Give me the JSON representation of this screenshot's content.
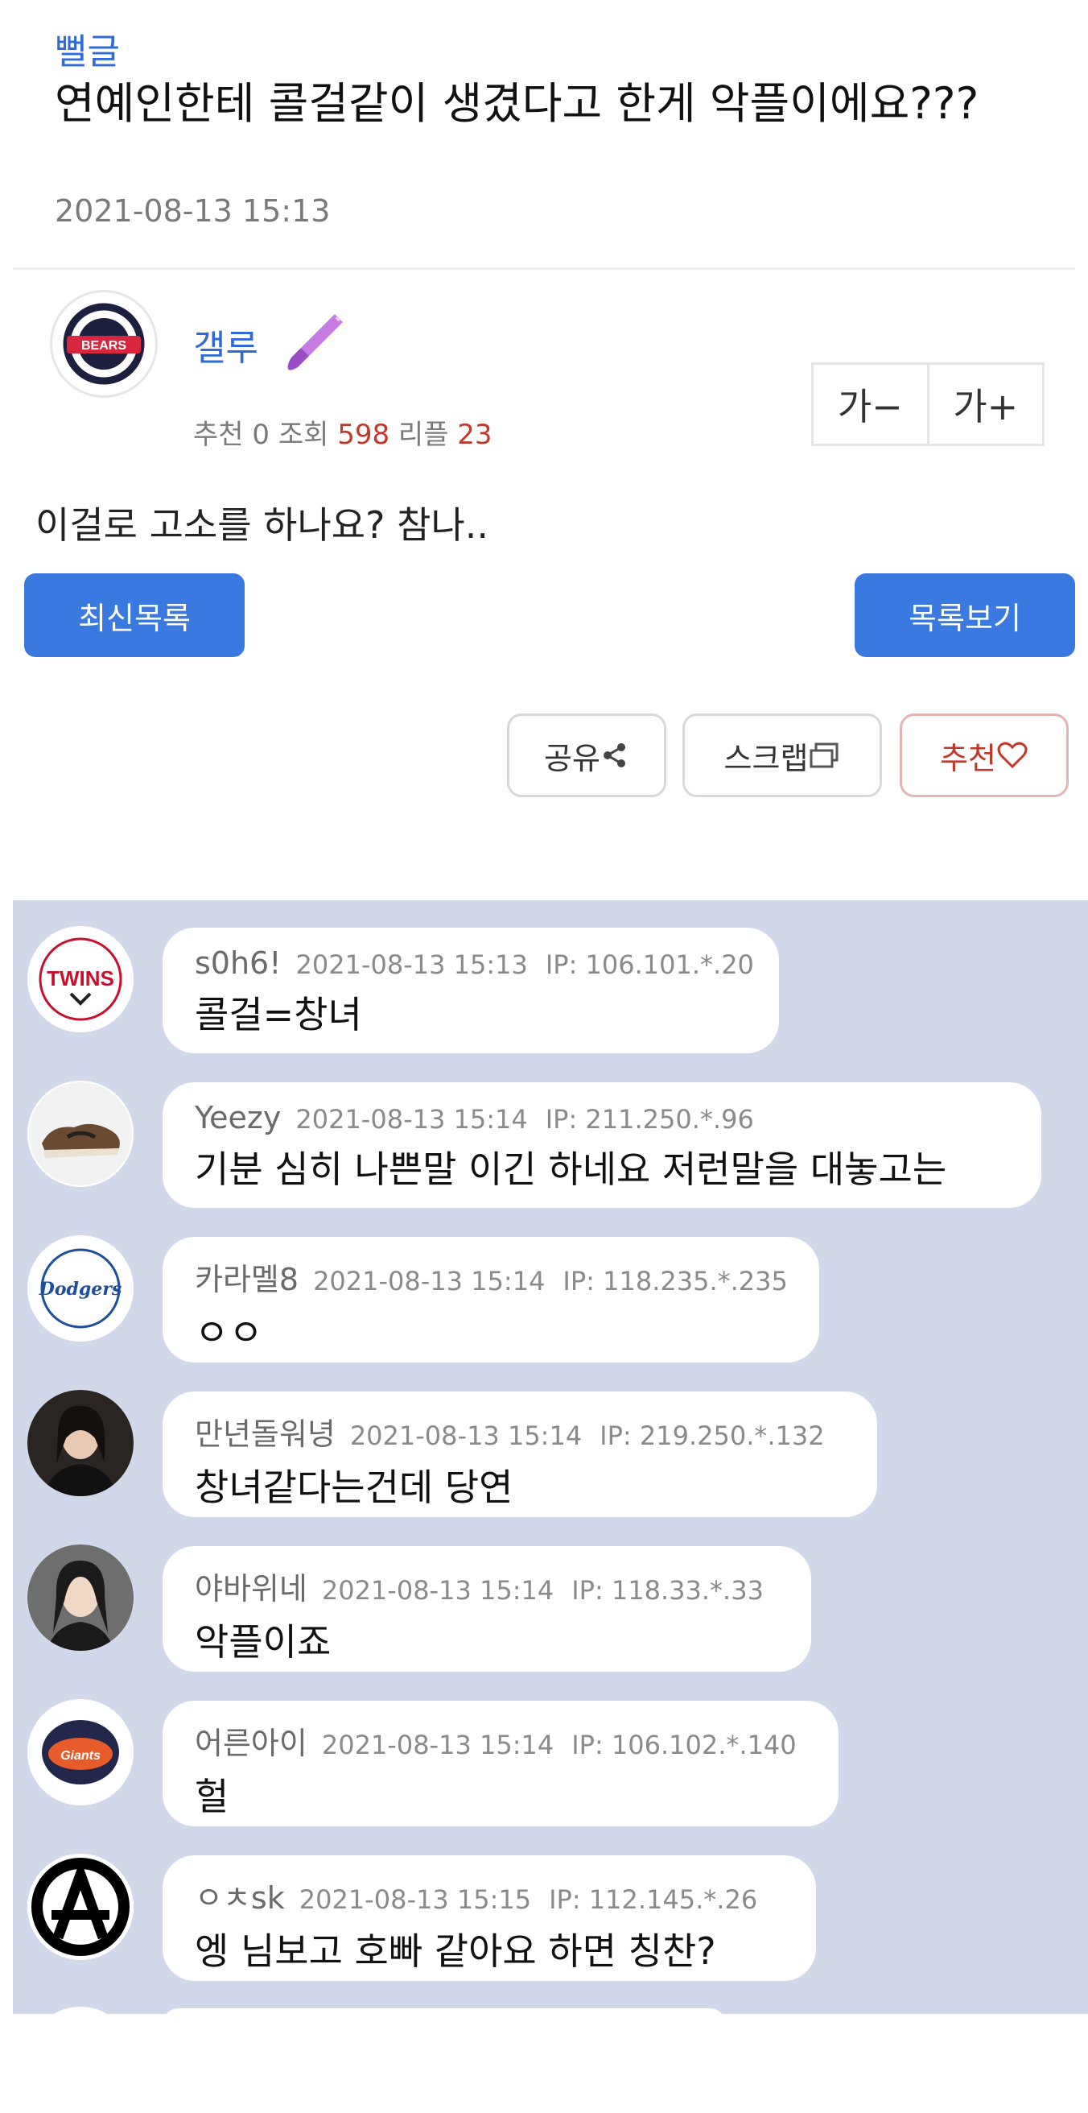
{
  "post": {
    "category": "뻘글",
    "title": "연예인한테 콜걸같이 생겼다고 한게 악플이에요???",
    "date": "2021-08-13 15:13",
    "author": "갤루",
    "stats": {
      "reco_label": "추천",
      "reco": "0",
      "views_label": "조회",
      "views": "598",
      "reply_label": "리플",
      "replies": "23"
    },
    "font_minus": "가−",
    "font_plus": "가+",
    "content": "이걸로 고소를 하나요? 참나..",
    "avatar_text": "BEARS"
  },
  "buttons": {
    "latest": "최신목록",
    "list": "목록보기",
    "share": "공유",
    "scrap": "스크랩",
    "recommend": "추천"
  },
  "colors": {
    "accent": "#3a7ae0",
    "comment_bg": "#d0d8ea",
    "highlight_red": "#c0392b"
  },
  "comments": [
    {
      "nick": "s0h6!",
      "date": "2021-08-13 15:13",
      "ip": "IP: 106.101.*.20",
      "text": "콜걸=창녀",
      "avatar": "TWINS"
    },
    {
      "nick": "Yeezy",
      "date": "2021-08-13 15:14",
      "ip": "IP: 211.250.*.96",
      "text": "기분 심히 나쁜말 이긴 하네요 저런말을 대놓고는",
      "avatar": "sneaker"
    },
    {
      "nick": "카라멜8",
      "date": "2021-08-13 15:14",
      "ip": "IP: 118.235.*.235",
      "text": "ㅇㅇ",
      "avatar": "Dodgers"
    },
    {
      "nick": "만년돌워녕",
      "date": "2021-08-13 15:14",
      "ip": "IP: 219.250.*.132",
      "text": "창녀같다는건데 당연",
      "avatar": "person"
    },
    {
      "nick": "야바위네",
      "date": "2021-08-13 15:14",
      "ip": "IP: 118.33.*.33",
      "text": "악플이죠",
      "avatar": "person"
    },
    {
      "nick": "어른아이",
      "date": "2021-08-13 15:14",
      "ip": "IP: 106.102.*.140",
      "text": "헐",
      "avatar": "Giants"
    },
    {
      "nick": "ㅇㅊsk",
      "date": "2021-08-13 15:15",
      "ip": "IP: 112.145.*.26",
      "text": "엥 님보고 호빠 같아요 하면 칭찬?",
      "avatar": "anarchy"
    }
  ]
}
